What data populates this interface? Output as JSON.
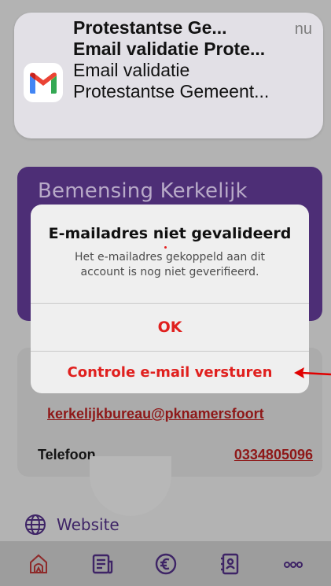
{
  "notification": {
    "sender": "Protestantse Ge...",
    "time": "nu",
    "subject": "Email validatie Prote...",
    "body_line1": "Email validatie",
    "body_line2": "Protestantse Gemeent...",
    "icon": "gmail-icon"
  },
  "background": {
    "card_title": "Bemensing Kerkelijk",
    "email": "kerkelijkbureau@pknamersfoort",
    "phone_label": "Telefoon",
    "phone_value": "0334805096",
    "website_label": "Website"
  },
  "alert": {
    "title": "E-mailadres niet gevalideerd",
    "message": "Het e-mailadres gekoppeld aan dit account is nog niet geverifieerd.",
    "ok_label": "OK",
    "send_label": "Controle e-mail versturen"
  },
  "tabbar": {
    "icons": [
      "home-icon",
      "news-icon",
      "euro-icon",
      "contacts-icon",
      "more-icon"
    ]
  },
  "colors": {
    "accent_red": "#e0201e",
    "brand_purple": "#4d2e76",
    "annotation_arrow": "#e00000"
  }
}
